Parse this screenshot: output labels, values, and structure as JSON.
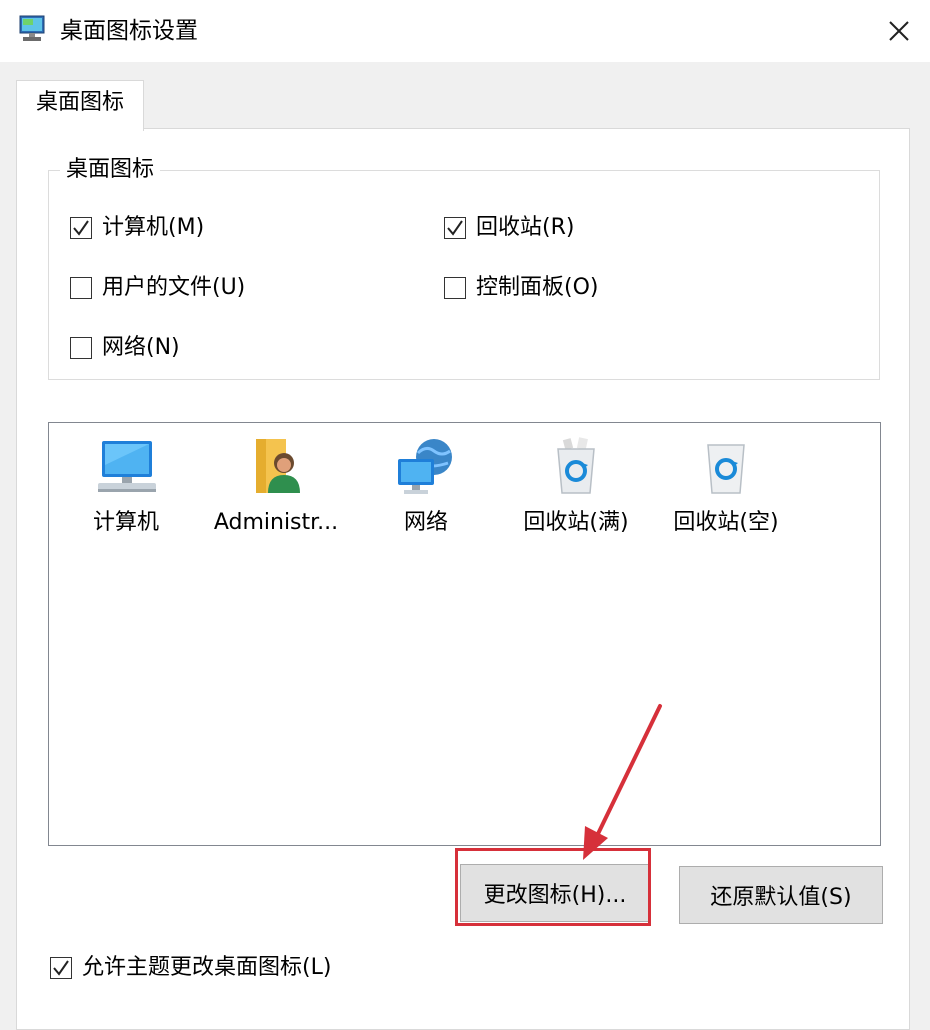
{
  "window": {
    "title": "桌面图标设置"
  },
  "tabs": [
    {
      "label": "桌面图标"
    }
  ],
  "group": {
    "legend": "桌面图标",
    "checkboxes": [
      {
        "label": "计算机(M)",
        "checked": true
      },
      {
        "label": "回收站(R)",
        "checked": true
      },
      {
        "label": "用户的文件(U)",
        "checked": false
      },
      {
        "label": "控制面板(O)",
        "checked": false
      },
      {
        "label": "网络(N)",
        "checked": false
      }
    ]
  },
  "icons": [
    {
      "label": "计算机",
      "icon": "computer-icon"
    },
    {
      "label": "Administr...",
      "icon": "user-folder-icon"
    },
    {
      "label": "网络",
      "icon": "network-icon"
    },
    {
      "label": "回收站(满)",
      "icon": "recycle-bin-full-icon"
    },
    {
      "label": "回收站(空)",
      "icon": "recycle-bin-empty-icon"
    }
  ],
  "buttons": {
    "change_icon": "更改图标(H)...",
    "restore_default": "还原默认值(S)"
  },
  "allow_themes": {
    "label": "允许主题更改桌面图标(L)",
    "checked": true
  },
  "colors": {
    "highlight": "#d6303a"
  }
}
